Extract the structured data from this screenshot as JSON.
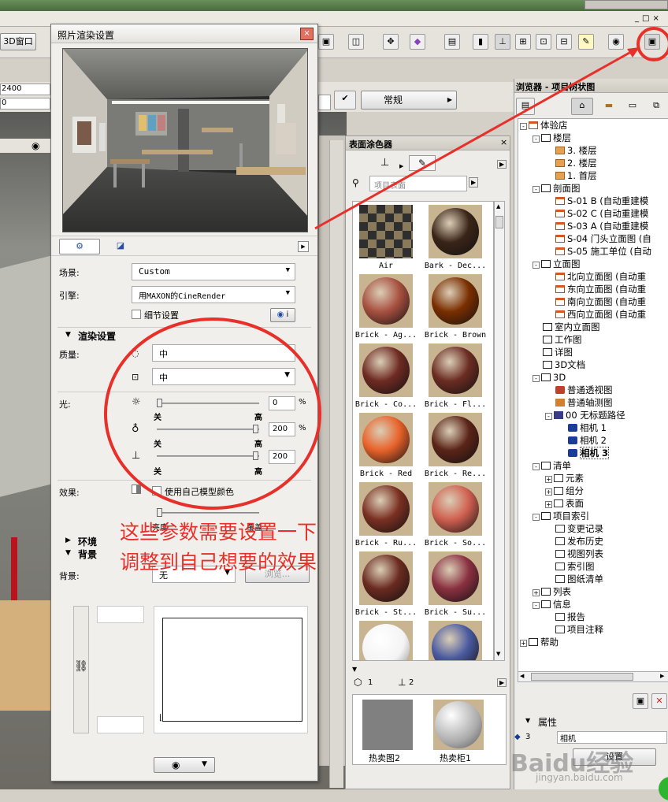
{
  "main": {
    "window_3d_button": "3D窗口",
    "coord_x": "2400",
    "coord_y": "0",
    "preset_label": "常规"
  },
  "dialog": {
    "title": "照片渲染设置",
    "scene_label": "场景:",
    "scene_value": "Custom",
    "engine_label": "引擎:",
    "engine_value": "用MAXON的CineRender",
    "detail_checkbox": "细节设置",
    "render_section": "渲染设置",
    "quality_label": "质量:",
    "quality_value_1": "中",
    "quality_value_2": "中",
    "light_label": "光:",
    "slider_min": "关",
    "slider_max": "高",
    "light_values": [
      "0",
      "200",
      "200"
    ],
    "light_levels": [
      0.0,
      1.0,
      1.0
    ],
    "percent": "%",
    "effects_label": "效果:",
    "effects_checkbox": "使用自己模型颜色",
    "effects_min": "亮度",
    "effects_max": "覆盖",
    "env_section": "环境",
    "bg_section": "背景",
    "bg_label": "背景:",
    "bg_value": "无",
    "browse_button": "浏览..."
  },
  "surface_painter": {
    "title": "表面涂色器",
    "search_placeholder": "项目表面",
    "materials": [
      "Air",
      "Bark - Dec...",
      "Brick - Ag...",
      "Brick - Brown",
      "Brick - Co...",
      "Brick - Fl...",
      "Brick - Red",
      "Brick - Re...",
      "Brick - Ru...",
      "Brick - So...",
      "Brick - St...",
      "Brick - Su..."
    ],
    "tab_count_1": "1",
    "tab_count_2": "2",
    "preview_items": [
      "热卖图2",
      "热卖柜1"
    ]
  },
  "navigator": {
    "title": "浏览器 - 项目树状图",
    "tree": [
      "体验店",
      "楼层",
      "3. 楼层",
      "2. 楼层",
      "1. 首层",
      "剖面图",
      "S-01 B (自动重建模",
      "S-02 C (自动重建模",
      "S-03 A (自动重建模",
      "S-04 门头立面图 (自",
      "S-05 施工单位 (自动",
      "立面图",
      "北向立面图 (自动重",
      "东向立面图 (自动重",
      "南向立面图 (自动重",
      "西向立面图 (自动重",
      "室内立面图",
      "工作图",
      "详图",
      "3D文档",
      "3D",
      "普通透视图",
      "普通轴测图",
      "00 无标题路径",
      "相机 1",
      "相机 2",
      "相机 3",
      "清单",
      "元素",
      "组分",
      "表面",
      "项目索引",
      "变更记录",
      "发布历史",
      "视图列表",
      "索引图",
      "图纸清单",
      "列表",
      "信息",
      "报告",
      "项目注释",
      "帮助"
    ],
    "properties_label": "属性",
    "prop_id": "3",
    "prop_type": "相机",
    "settings_button": "设置"
  },
  "annotation": {
    "line1": "这些参数需要设置一下",
    "line2": "调整到自己想要的效果",
    "color": "#e8302a"
  },
  "watermark": {
    "brand": "Baidu经验",
    "url": "jingyan.baidu.com"
  }
}
